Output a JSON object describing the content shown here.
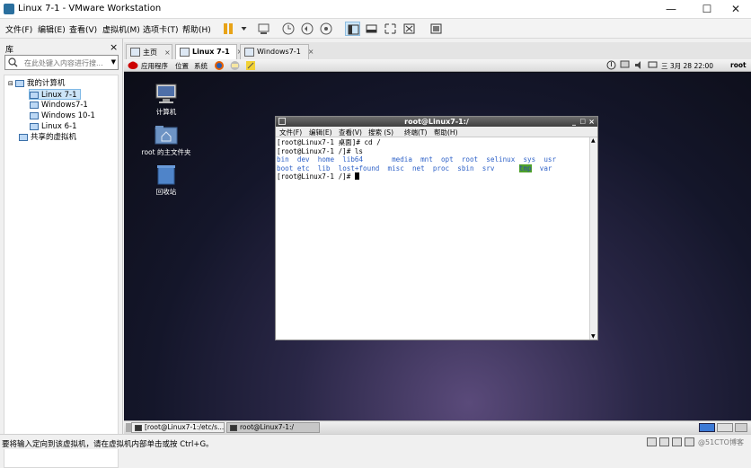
{
  "window": {
    "title": "Linux 7-1 - VMware Workstation",
    "minimize": "—",
    "maximize": "☐",
    "close": "✕"
  },
  "menubar": {
    "items": [
      "文件(F)",
      "编辑(E)",
      "查看(V)",
      "虚拟机(M)",
      "选项卡(T)",
      "帮助(H)"
    ]
  },
  "sidebar": {
    "title": "库",
    "close": "×",
    "search_placeholder": "在此处键入内容进行搜...",
    "tree": {
      "root": "我的计算机",
      "vms": [
        "Linux 7-1",
        "Windows7-1",
        "Windows 10-1",
        "Linux 6-1"
      ],
      "shared": "共享的虚拟机"
    }
  },
  "tabs": [
    {
      "label": "主页",
      "close": "×"
    },
    {
      "label": "Linux 7-1",
      "close": "×"
    },
    {
      "label": "Windows7-1",
      "close": "×"
    }
  ],
  "guest_panel": {
    "apps": "应用程序",
    "places": "位置",
    "system": "系统",
    "clock": "三  3月 28 22:00",
    "user": "root"
  },
  "desktop_icons": [
    "计算机",
    "root 的主文件夹",
    "回收站"
  ],
  "terminal": {
    "title": "root@Linux7-1:/",
    "menu": [
      "文件(F)",
      "编辑(E)",
      "查看(V)",
      "搜索 (S)",
      "终端(T)",
      "帮助(H)"
    ],
    "line1": "[root@Linux7-1 桌面]# cd /",
    "line2": "[root@Linux7-1 /]# ls",
    "ls_row1": [
      "bin",
      "dev",
      "home",
      "lib64",
      "media",
      "mnt",
      "opt",
      "root",
      "selinux",
      "sys",
      "usr"
    ],
    "ls_row2": [
      "boot",
      "etc",
      "lib",
      "lost+found",
      "misc",
      "net",
      "proc",
      "sbin",
      "srv",
      "tmp",
      "var"
    ],
    "prompt": "[root@Linux7-1 /]# "
  },
  "guest_taskbar": [
    "[root@Linux7-1:/etc/s...",
    "root@Linux7-1:/"
  ],
  "statusbar": {
    "text": "要将输入定向到该虚拟机，请在虚拟机内部单击或按 Ctrl+G。",
    "watermark": "@51CTO博客"
  },
  "colors": {
    "accent": "#0078d7",
    "terminal_blue": "#2f62c8",
    "tmp_bg": "#4ea12b"
  }
}
